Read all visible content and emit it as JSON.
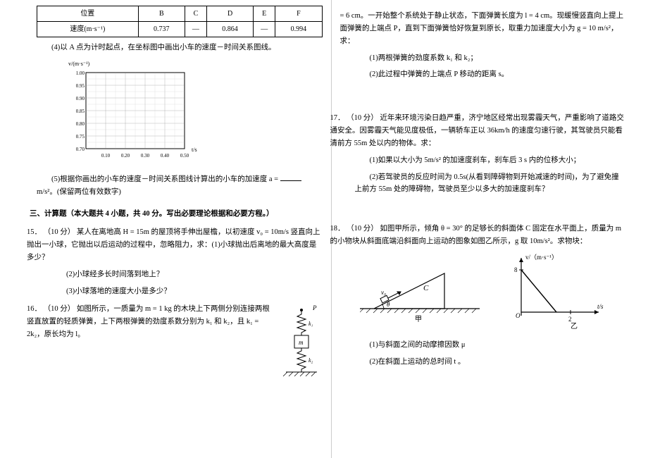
{
  "table": {
    "row1_label": "位置",
    "cols": [
      "B",
      "C",
      "D",
      "E",
      "F"
    ],
    "row2_label": "速度(m·s⁻¹)",
    "vals": [
      "0.737",
      "—",
      "0.864",
      "—",
      "0.994"
    ]
  },
  "q4_prompt": "(4)以 A 点为计时起点，在坐标图中画出小车的速度－时间关系图线。",
  "chart_data": {
    "type": "scatter",
    "title": "v/(m·s⁻¹) vs t/s",
    "xlabel": "t/s",
    "ylabel": "v/(m·s⁻¹)",
    "x_ticks": [
      0.1,
      0.2,
      0.3,
      0.4,
      0.5
    ],
    "y_ticks": [
      0.7,
      0.75,
      0.8,
      0.85,
      0.9,
      0.95,
      1.0
    ],
    "xlim": [
      0.0,
      0.55
    ],
    "ylim": [
      0.7,
      1.0
    ],
    "series": []
  },
  "q5_prompt_pre": "(5)根据你画出的小车的速度－时间关系图线计算出的小车的加速度 a =",
  "q5_unit": "m/s²。(保留两位有效数字)",
  "section3": "三、计算题（本大题共 4 小题，共 40 分。写出必要理论根据和必要方程。）",
  "q15": {
    "num": "15．",
    "pts": "（10 分）",
    "body": "某人在离地高 H = 15m 的屋顶将手伸出屋檐，以初速度 v₀ = 10m/s 竖直向上抛出一小球，它抛出以后运动的过程中，忽略阻力，求：(1)小球抛出后离地的最大高度是多少？",
    "p2": "(2)小球经多长时间落到地上？",
    "p3": "(3)小球落地的速度大小是多少？"
  },
  "q16": {
    "num": "16．",
    "pts": "（10 分）",
    "body": "如图所示，一质量为 m = 1 kg 的木块上下两侧分别连接两根竖直放置的轻质弹簧，上下两根弹簧的劲度系数分别为 k₁ 和 k₂，且 k₁ = 2k₂，原长均为 l₀",
    "cont": "= 6 cm。一开始整个系统处于静止状态，下面弹簧长度为 l = 4 cm。现缓慢竖直向上提上面弹簧的上端点 P，直到下面弹簧恰好恢复到原长，取重力加速度大小为 g = 10 m/s²，求：",
    "p1": "(1)两根弹簧的劲度系数 k₁ 和 k₂；",
    "p2": "(2)此过程中弹簧的上端点 P 移动的距离 s。"
  },
  "q17": {
    "num": "17．",
    "pts": "（10 分）",
    "body": "近年来环境污染日趋严重，济宁地区经常出现雾霾天气，严重影响了道路交通安全。因雾霾天气能见度极低，一辆轿车正以 36km/h 的速度匀速行驶，其驾驶员只能看清前方 55m 处以内的物体。求：",
    "p1": "(1)如果以大小为 5m/s² 的加速度刹车，刹车后 3 s 内的位移大小；",
    "p2": "(2)若驾驶员的反应时间为 0.5s(从看到障碍物到开始减速的时间)，为了避免撞上前方 55m 处的障碍物，驾驶员至少以多大的加速度刹车？"
  },
  "q18": {
    "num": "18．",
    "pts": "（10 分）",
    "body": "如图甲所示，倾角 θ = 30° 的足够长的斜面体 C 固定在水平面上，质量为 m 的小物块从斜面底端沿斜面向上运动的图象如图乙所示，g 取 10m/s²。求物块：",
    "p1": "(1)与斜面之间的动摩擦因数 μ",
    "p2": "(2)在斜面上运动的总时间 t 。"
  },
  "incline_labels": {
    "C": "C",
    "theta": "θ",
    "v0": "v₀",
    "cap": "甲"
  },
  "graph_labels": {
    "y": "v/（m·s⁻¹）",
    "ymax": "8",
    "x": "t/s",
    "xmax": "2",
    "cap": "乙",
    "O": "O"
  }
}
